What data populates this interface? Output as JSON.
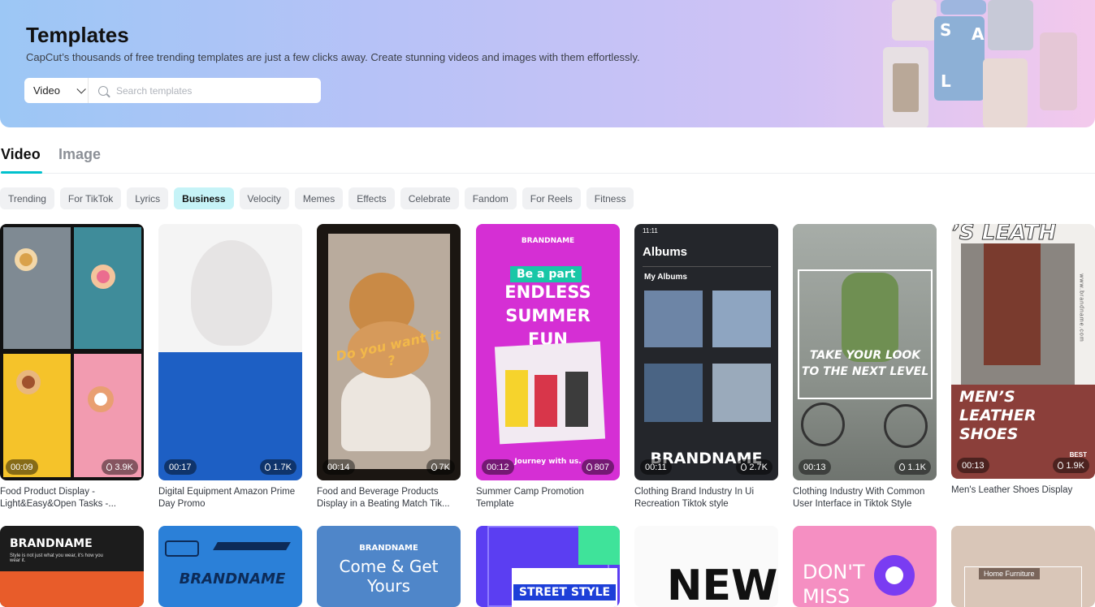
{
  "header": {
    "title": "Templates",
    "subtitle": "CapCut’s thousands of free trending templates are just a few clicks away. Create stunning videos and images with them effortlessly.",
    "type_select": "Video",
    "search_placeholder": "Search templates"
  },
  "tabs": [
    {
      "label": "Video",
      "active": true
    },
    {
      "label": "Image",
      "active": false
    }
  ],
  "chips": [
    {
      "label": "Trending",
      "active": false
    },
    {
      "label": "For TikTok",
      "active": false
    },
    {
      "label": "Lyrics",
      "active": false
    },
    {
      "label": "Business",
      "active": true
    },
    {
      "label": "Velocity",
      "active": false
    },
    {
      "label": "Memes",
      "active": false
    },
    {
      "label": "Effects",
      "active": false
    },
    {
      "label": "Celebrate",
      "active": false
    },
    {
      "label": "Fandom",
      "active": false
    },
    {
      "label": "For Reels",
      "active": false
    },
    {
      "label": "Fitness",
      "active": false
    }
  ],
  "cards": [
    {
      "title": "Food Product Display - Light&Easy&Open Tasks -...",
      "duration": "00:09",
      "uses": "3.9K"
    },
    {
      "title": "Digital Equipment Amazon Prime Day Promo",
      "duration": "00:17",
      "uses": "1.7K"
    },
    {
      "title": "Food and Beverage Products Display in a Beating Match Tik...",
      "duration": "00:14",
      "uses": "7K",
      "overlay": "Do you want it ?"
    },
    {
      "title": "Summer Camp Promotion Template",
      "duration": "00:12",
      "uses": "807",
      "brand": "BRANDNAME",
      "tag": "Be a part",
      "headline": "ENDLESS SUMMER FUN",
      "footer": "Journey with us."
    },
    {
      "title": "Clothing Brand Industry In Ui Recreation Tiktok style",
      "duration": "00:11",
      "uses": "2.7K",
      "status_time": "11:11",
      "albums": "Albums",
      "my_albums": "My Albums",
      "brand": "BRANDNAME"
    },
    {
      "title": "Clothing Industry With Common User Interface in Tiktok Style",
      "duration": "00:13",
      "uses": "1.1K",
      "headline": "TAKE YOUR LOOK TO THE NEXT LEVEL"
    },
    {
      "title": "Men's Leather Shoes Display",
      "duration": "00:13",
      "uses": "1.9K",
      "headline": "MEN’S LEATHER SHOES",
      "top": "’S LEATH",
      "side": "www.brandname.com",
      "best": "BEST"
    }
  ],
  "row2": [
    {
      "text": "BRANDNAME",
      "sub": "Style is not just what you wear, it's how you wear it."
    },
    {
      "text": "BRANDNAME"
    },
    {
      "text": "BRANDNAME",
      "sub": "Come & Get Yours"
    },
    {
      "text": "STREET STYLE"
    },
    {
      "text": "NEW"
    },
    {
      "text": "DON'T MISS OUT"
    },
    {
      "text": "Home Furniture"
    }
  ],
  "colors": {
    "accent": "#00c1cd",
    "chip_active_bg": "#c6f3f7"
  }
}
